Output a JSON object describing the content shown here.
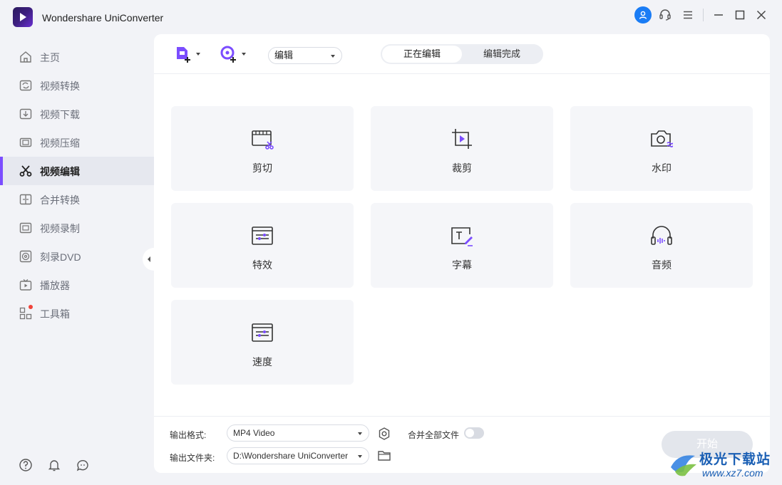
{
  "app": {
    "title": "Wondershare UniConverter"
  },
  "colors": {
    "accent": "#7b4dff",
    "user_blue": "#1a7cf5",
    "active_bg": "#e6e8ef"
  },
  "sidebar": {
    "items": [
      {
        "label": "主页",
        "icon": "home-icon"
      },
      {
        "label": "视频转换",
        "icon": "convert-icon"
      },
      {
        "label": "视频下载",
        "icon": "download-icon"
      },
      {
        "label": "视频压缩",
        "icon": "compress-icon"
      },
      {
        "label": "视频编辑",
        "icon": "scissors-icon",
        "active": true
      },
      {
        "label": "合并转换",
        "icon": "merge-icon"
      },
      {
        "label": "视频录制",
        "icon": "record-icon"
      },
      {
        "label": "刻录DVD",
        "icon": "dvd-icon"
      },
      {
        "label": "播放器",
        "icon": "player-icon"
      },
      {
        "label": "工具箱",
        "icon": "toolbox-icon"
      }
    ]
  },
  "toolbar": {
    "mode_select": "编辑",
    "tabs": [
      {
        "label": "正在编辑",
        "active": true
      },
      {
        "label": "编辑完成"
      }
    ]
  },
  "cards": [
    {
      "label": "剪切",
      "icon": "trim-icon"
    },
    {
      "label": "裁剪",
      "icon": "crop-icon"
    },
    {
      "label": "水印",
      "icon": "watermark-icon"
    },
    {
      "label": "特效",
      "icon": "effects-icon"
    },
    {
      "label": "字幕",
      "icon": "subtitle-icon"
    },
    {
      "label": "音频",
      "icon": "audio-icon"
    },
    {
      "label": "速度",
      "icon": "speed-icon"
    }
  ],
  "footer": {
    "format_label": "输出格式:",
    "format_value": "MP4 Video",
    "merge_label": "合并全部文件",
    "folder_label": "输出文件夹:",
    "folder_value": "D:\\Wondershare UniConverter",
    "start_label": "开始"
  },
  "watermark": {
    "text": "极光下载站",
    "url": "www.xz7.com"
  }
}
